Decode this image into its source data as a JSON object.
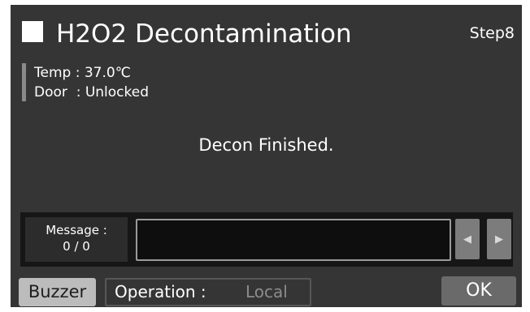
{
  "header": {
    "title": "H2O2 Decontamination",
    "step": "Step8"
  },
  "status": {
    "temp_label": "Temp",
    "temp_value": "37.0℃",
    "door_label": "Door",
    "door_value": "Unlocked"
  },
  "main_message": "Decon Finished.",
  "message_panel": {
    "label": "Message :",
    "count": "0 / 0",
    "text": "",
    "prev_icon": "triangle-left",
    "next_icon": "triangle-right"
  },
  "footer": {
    "buzzer_label": "Buzzer",
    "operation_label": "Operation :",
    "operation_value": "Local",
    "ok_label": "OK"
  },
  "colors": {
    "background": "#353535",
    "panel": "#161616",
    "button_light": "#bcbcbc",
    "button_dark": "#6a6a6a"
  }
}
